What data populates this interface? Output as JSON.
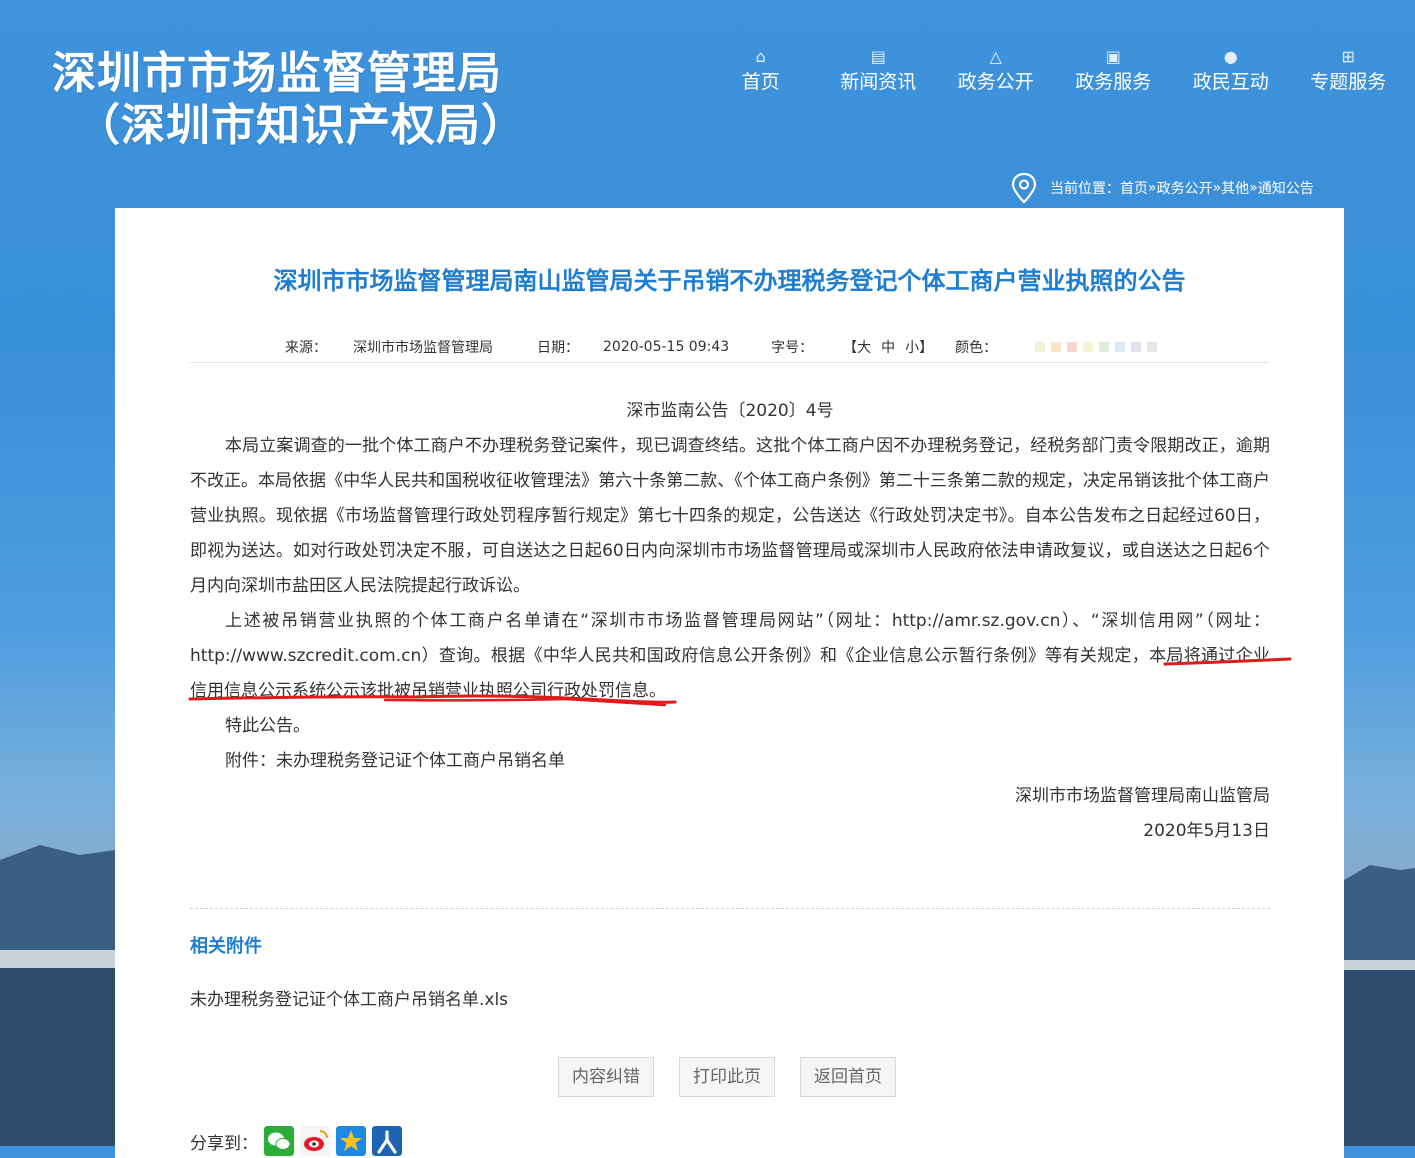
{
  "header": {
    "title_line1": "深圳市市场监督管理局",
    "title_line2": "（深圳市知识产权局）"
  },
  "nav": [
    {
      "label": "首页",
      "icon": "home-icon"
    },
    {
      "label": "新闻资讯",
      "icon": "news-icon"
    },
    {
      "label": "政务公开",
      "icon": "triangle-icon"
    },
    {
      "label": "政务服务",
      "icon": "briefcase-icon"
    },
    {
      "label": "政民互动",
      "icon": "chat-icon"
    },
    {
      "label": "专题服务",
      "icon": "grid-icon"
    }
  ],
  "breadcrumb": {
    "prefix": "当前位置：",
    "items": [
      "首页",
      "政务公开",
      "其他",
      "通知公告"
    ],
    "sep": "»"
  },
  "article": {
    "title": "深圳市市场监督管理局南山监管局关于吊销不办理税务登记个体工商户营业执照的公告",
    "meta": {
      "source_label": "来源：",
      "source": "深圳市市场监督管理局",
      "date_label": "日期：",
      "date": "2020-05-15 09:43",
      "size_label": "字号：",
      "size_open": "【",
      "size_large": "大",
      "size_medium": "中",
      "size_small": "小",
      "size_close": "】",
      "color_label": "颜色："
    },
    "swatches": [
      "#f6f1d9",
      "#f7e6c8",
      "#f6d6cf",
      "#f5f5d6",
      "#dcefdc",
      "#dce8f4",
      "#e8e0f0",
      "#e6e6e6"
    ],
    "doc_no": "深市监南公告〔2020〕4号",
    "p1": "本局立案调查的一批个体工商户不办理税务登记案件，现已调查终结。这批个体工商户因不办理税务登记，经税务部门责令限期改正，逾期不改正。本局依据《中华人民共和国税收征收管理法》第六十条第二款、《个体工商户条例》第二十三条第二款的规定，决定吊销该批个体工商户营业执照。现依据《市场监督管理行政处罚程序暂行规定》第七十四条的规定，公告送达《行政处罚决定书》。自本公告发布之日起经过60日，即视为送达。如对行政处罚决定不服，可自送达之日起60日内向深圳市市场监督管理局或深圳市人民政府依法申请政复议，或自送达之日起6个月内向深圳市盐田区人民法院提起行政诉讼。",
    "p2_a": "上述被吊销营业执照的个体工商户名单请在“深圳市市场监督管理局网站”（网址：http://amr.sz.gov.cn）、“深圳信用网”（网址：http://www.szcredit.com.cn）查询。根据《中华人民共和国政府信息公开条例》和《企业信息公示暂行条例》等有关规定，",
    "p2_b": "本局将通过企业信用信息公示系统公示该批被吊销营业执照公司行政处罚信息",
    "p2_c": "。",
    "p3": "特此公告。",
    "p4": "附件：未办理税务登记证个体工商户吊销名单",
    "signature": "深圳市市场监督管理局南山监管局",
    "sign_date": "2020年5月13日"
  },
  "attachments": {
    "title": "相关附件",
    "file": "未办理税务登记证个体工商户吊销名单.xls"
  },
  "buttons": {
    "correct": "内容纠错",
    "print": "打印此页",
    "home": "返回首页"
  },
  "share": {
    "label": "分享到："
  }
}
